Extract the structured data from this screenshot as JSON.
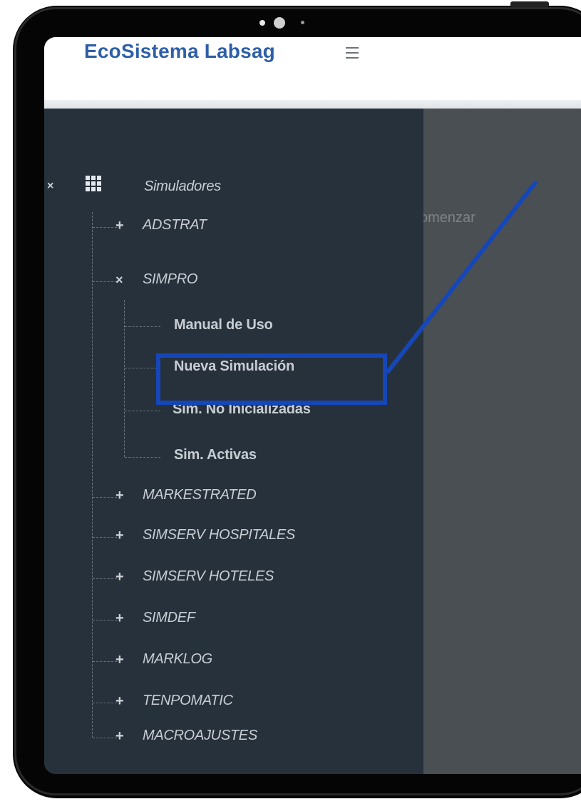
{
  "app": {
    "title": "EcoSistema Labsag"
  },
  "content": {
    "partial_text": "comenzar"
  },
  "menu": {
    "root_label": "Simuladores",
    "items": [
      {
        "label": "ADSTRAT",
        "state": "collapsed"
      },
      {
        "label": "SIMPRO",
        "state": "expanded",
        "children": [
          {
            "label": "Manual de Uso"
          },
          {
            "label": "Nueva Simulación"
          },
          {
            "label": "Sim. No Inicializadas",
            "highlighted": true
          },
          {
            "label": "Sim. Activas"
          }
        ]
      },
      {
        "label": "MARKESTRATED",
        "state": "collapsed"
      },
      {
        "label": "SIMSERV HOSPITALES",
        "state": "collapsed"
      },
      {
        "label": "SIMSERV HOTELES",
        "state": "collapsed"
      },
      {
        "label": "SIMDEF",
        "state": "collapsed"
      },
      {
        "label": "MARKLOG",
        "state": "collapsed"
      },
      {
        "label": "TENPOMATIC",
        "state": "collapsed"
      },
      {
        "label": "MACROAJUSTES",
        "state": "collapsed"
      }
    ]
  },
  "colors": {
    "brand": "#2e5fa8",
    "sidebar": "#27313b",
    "content": "#4a4f54",
    "highlight": "#1647b8"
  },
  "icons": [
    "hamburger-icon",
    "close-icon",
    "grid-icon",
    "expand-plus-icon",
    "collapse-x-icon"
  ]
}
